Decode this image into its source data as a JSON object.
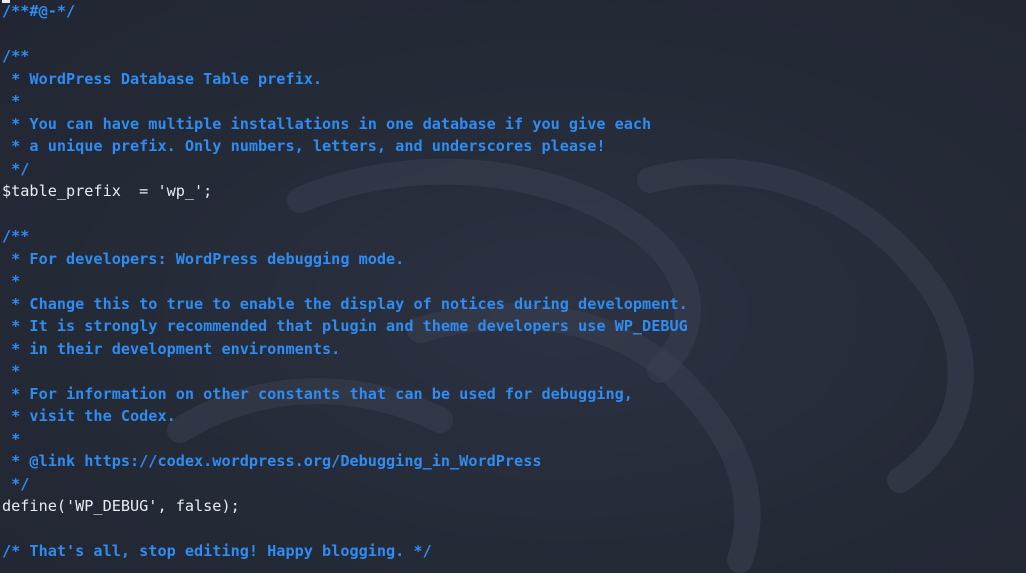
{
  "editor": {
    "lines": [
      {
        "text": "/**#@-*/",
        "kind": "comment"
      },
      {
        "text": "",
        "kind": "blank"
      },
      {
        "text": "/**",
        "kind": "comment"
      },
      {
        "text": " * WordPress Database Table prefix.",
        "kind": "comment"
      },
      {
        "text": " *",
        "kind": "comment"
      },
      {
        "text": " * You can have multiple installations in one database if you give each",
        "kind": "comment"
      },
      {
        "text": " * a unique prefix. Only numbers, letters, and underscores please!",
        "kind": "comment"
      },
      {
        "text": " */",
        "kind": "comment"
      },
      {
        "text": "$table_prefix  = 'wp_';",
        "kind": "code"
      },
      {
        "text": "",
        "kind": "blank"
      },
      {
        "text": "/**",
        "kind": "comment"
      },
      {
        "text": " * For developers: WordPress debugging mode.",
        "kind": "comment"
      },
      {
        "text": " *",
        "kind": "comment"
      },
      {
        "text": " * Change this to true to enable the display of notices during development.",
        "kind": "comment"
      },
      {
        "text": " * It is strongly recommended that plugin and theme developers use WP_DEBUG",
        "kind": "comment"
      },
      {
        "text": " * in their development environments.",
        "kind": "comment"
      },
      {
        "text": " *",
        "kind": "comment"
      },
      {
        "text": " * For information on other constants that can be used for debugging,",
        "kind": "comment"
      },
      {
        "text": " * visit the Codex.",
        "kind": "comment"
      },
      {
        "text": " *",
        "kind": "comment"
      },
      {
        "text": " * @link https://codex.wordpress.org/Debugging_in_WordPress",
        "kind": "comment"
      },
      {
        "text": " */",
        "kind": "comment"
      },
      {
        "text": "define('WP_DEBUG', false);",
        "kind": "code"
      },
      {
        "text": "",
        "kind": "blank"
      },
      {
        "text": "/* That's all, stop editing! Happy blogging. */",
        "kind": "comment"
      }
    ]
  },
  "colors": {
    "background": "#262b38",
    "comment": "#2f8cf0",
    "code": "#e8ecf2"
  }
}
